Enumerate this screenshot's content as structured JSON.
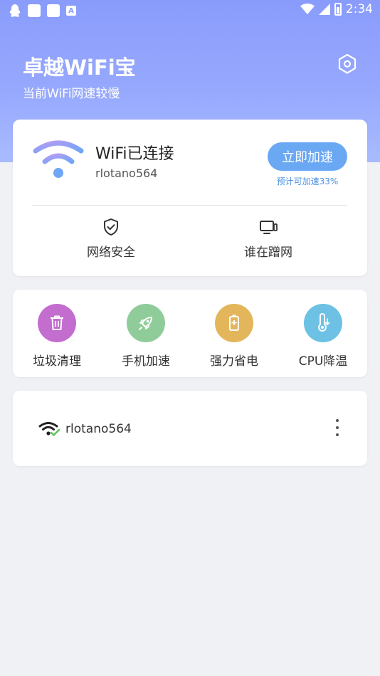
{
  "status_bar": {
    "time": "2:34",
    "battery_icon": "battery-charging-icon",
    "wifi_icon": "wifi-signal-icon",
    "cell_icon": "cell-signal-icon"
  },
  "header": {
    "title": "卓越WiFi宝",
    "subtitle": "当前WiFi网速较慢",
    "settings_icon": "settings-hexagon-icon",
    "gradient_color": "#8a9cfb"
  },
  "connection": {
    "status": "WiFi已连接",
    "ssid": "rlotano564",
    "boost_label": "立即加速",
    "boost_hint": "预计可加速33%",
    "accent_color": "#6aa8f4"
  },
  "features": [
    {
      "label": "网络安全",
      "icon": "shield-check-icon"
    },
    {
      "label": "谁在蹭网",
      "icon": "devices-icon"
    }
  ],
  "tools": [
    {
      "label": "垃圾清理",
      "icon": "trash-icon",
      "color": "#c36dcf"
    },
    {
      "label": "手机加速",
      "icon": "rocket-icon",
      "color": "#8fcc99"
    },
    {
      "label": "强力省电",
      "icon": "battery-icon",
      "color": "#e3b65c"
    },
    {
      "label": "CPU降温",
      "icon": "thermometer-icon",
      "color": "#6cc1e4"
    }
  ],
  "network_list": [
    {
      "name": "rlotano564",
      "icon": "wifi-connected-icon"
    }
  ]
}
